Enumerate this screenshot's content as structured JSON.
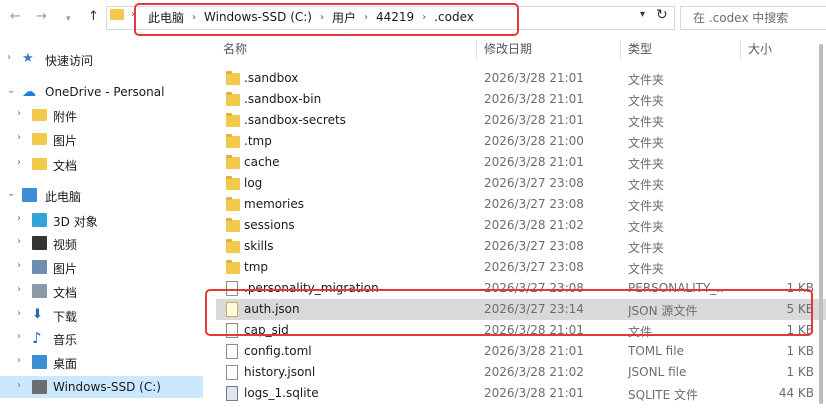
{
  "address_bar": {
    "breadcrumbs": [
      "此电脑",
      "Windows-SSD (C:)",
      "用户",
      "44219",
      ".codex"
    ],
    "search_placeholder": "在 .codex 中搜索"
  },
  "columns": {
    "name": "名称",
    "date": "修改日期",
    "type": "类型",
    "size": "大小"
  },
  "sidebar": {
    "items": [
      {
        "label": "快速访问",
        "icon": "star-icon",
        "indent": 0
      },
      {
        "label": "OneDrive - Personal",
        "icon": "cloud-icon",
        "indent": 0,
        "expanded": true
      },
      {
        "label": "附件",
        "icon": "folder-icon",
        "indent": 1
      },
      {
        "label": "图片",
        "icon": "folder-icon",
        "indent": 1
      },
      {
        "label": "文档",
        "icon": "folder-icon",
        "indent": 1,
        "selected": true
      },
      {
        "label": "此电脑",
        "icon": "computer-icon",
        "indent": 0,
        "expanded": true
      },
      {
        "label": "3D 对象",
        "icon": "cube-icon",
        "indent": 1
      },
      {
        "label": "视频",
        "icon": "video-icon",
        "indent": 1
      },
      {
        "label": "图片",
        "icon": "pictures-icon",
        "indent": 1
      },
      {
        "label": "文档",
        "icon": "documents-icon",
        "indent": 1
      },
      {
        "label": "下载",
        "icon": "download-icon",
        "indent": 1
      },
      {
        "label": "音乐",
        "icon": "music-icon",
        "indent": 1
      },
      {
        "label": "桌面",
        "icon": "desktop-icon",
        "indent": 1
      },
      {
        "label": "Windows-SSD (C:)",
        "icon": "drive-icon",
        "indent": 1,
        "selected": true
      }
    ]
  },
  "files": [
    {
      "name": ".sandbox",
      "date": "2026/3/28 21:01",
      "type": "文件夹",
      "size": "",
      "kind": "folder"
    },
    {
      "name": ".sandbox-bin",
      "date": "2026/3/28 21:01",
      "type": "文件夹",
      "size": "",
      "kind": "folder"
    },
    {
      "name": ".sandbox-secrets",
      "date": "2026/3/28 21:01",
      "type": "文件夹",
      "size": "",
      "kind": "folder"
    },
    {
      "name": ".tmp",
      "date": "2026/3/28 21:00",
      "type": "文件夹",
      "size": "",
      "kind": "folder"
    },
    {
      "name": "cache",
      "date": "2026/3/28 21:01",
      "type": "文件夹",
      "size": "",
      "kind": "folder"
    },
    {
      "name": "log",
      "date": "2026/3/27 23:08",
      "type": "文件夹",
      "size": "",
      "kind": "folder"
    },
    {
      "name": "memories",
      "date": "2026/3/27 23:08",
      "type": "文件夹",
      "size": "",
      "kind": "folder"
    },
    {
      "name": "sessions",
      "date": "2026/3/28 21:02",
      "type": "文件夹",
      "size": "",
      "kind": "folder"
    },
    {
      "name": "skills",
      "date": "2026/3/27 23:08",
      "type": "文件夹",
      "size": "",
      "kind": "folder"
    },
    {
      "name": "tmp",
      "date": "2026/3/27 23:08",
      "type": "文件夹",
      "size": "",
      "kind": "folder"
    },
    {
      "name": ".personality_migration",
      "date": "2026/3/27 23:08",
      "type": "PERSONALITY_...",
      "size": "1 KB",
      "kind": "file"
    },
    {
      "name": "auth.json",
      "date": "2026/3/27 23:14",
      "type": "JSON 源文件",
      "size": "5 KB",
      "kind": "json",
      "selected": true
    },
    {
      "name": "cap_sid",
      "date": "2026/3/28 21:01",
      "type": "文件",
      "size": "1 KB",
      "kind": "file"
    },
    {
      "name": "config.toml",
      "date": "2026/3/28 21:01",
      "type": "TOML file",
      "size": "1 KB",
      "kind": "file"
    },
    {
      "name": "history.jsonl",
      "date": "2026/3/28 21:02",
      "type": "JSONL file",
      "size": "1 KB",
      "kind": "file"
    },
    {
      "name": "logs_1.sqlite",
      "date": "2026/3/28 21:01",
      "type": "SQLITE 文件",
      "size": "44 KB",
      "kind": "sqlite"
    }
  ],
  "colors": {
    "highlight_box": "#e53935",
    "selection": "#cce8ff",
    "row_selected": "#d9d9d9",
    "folder": "#f3c94b"
  }
}
